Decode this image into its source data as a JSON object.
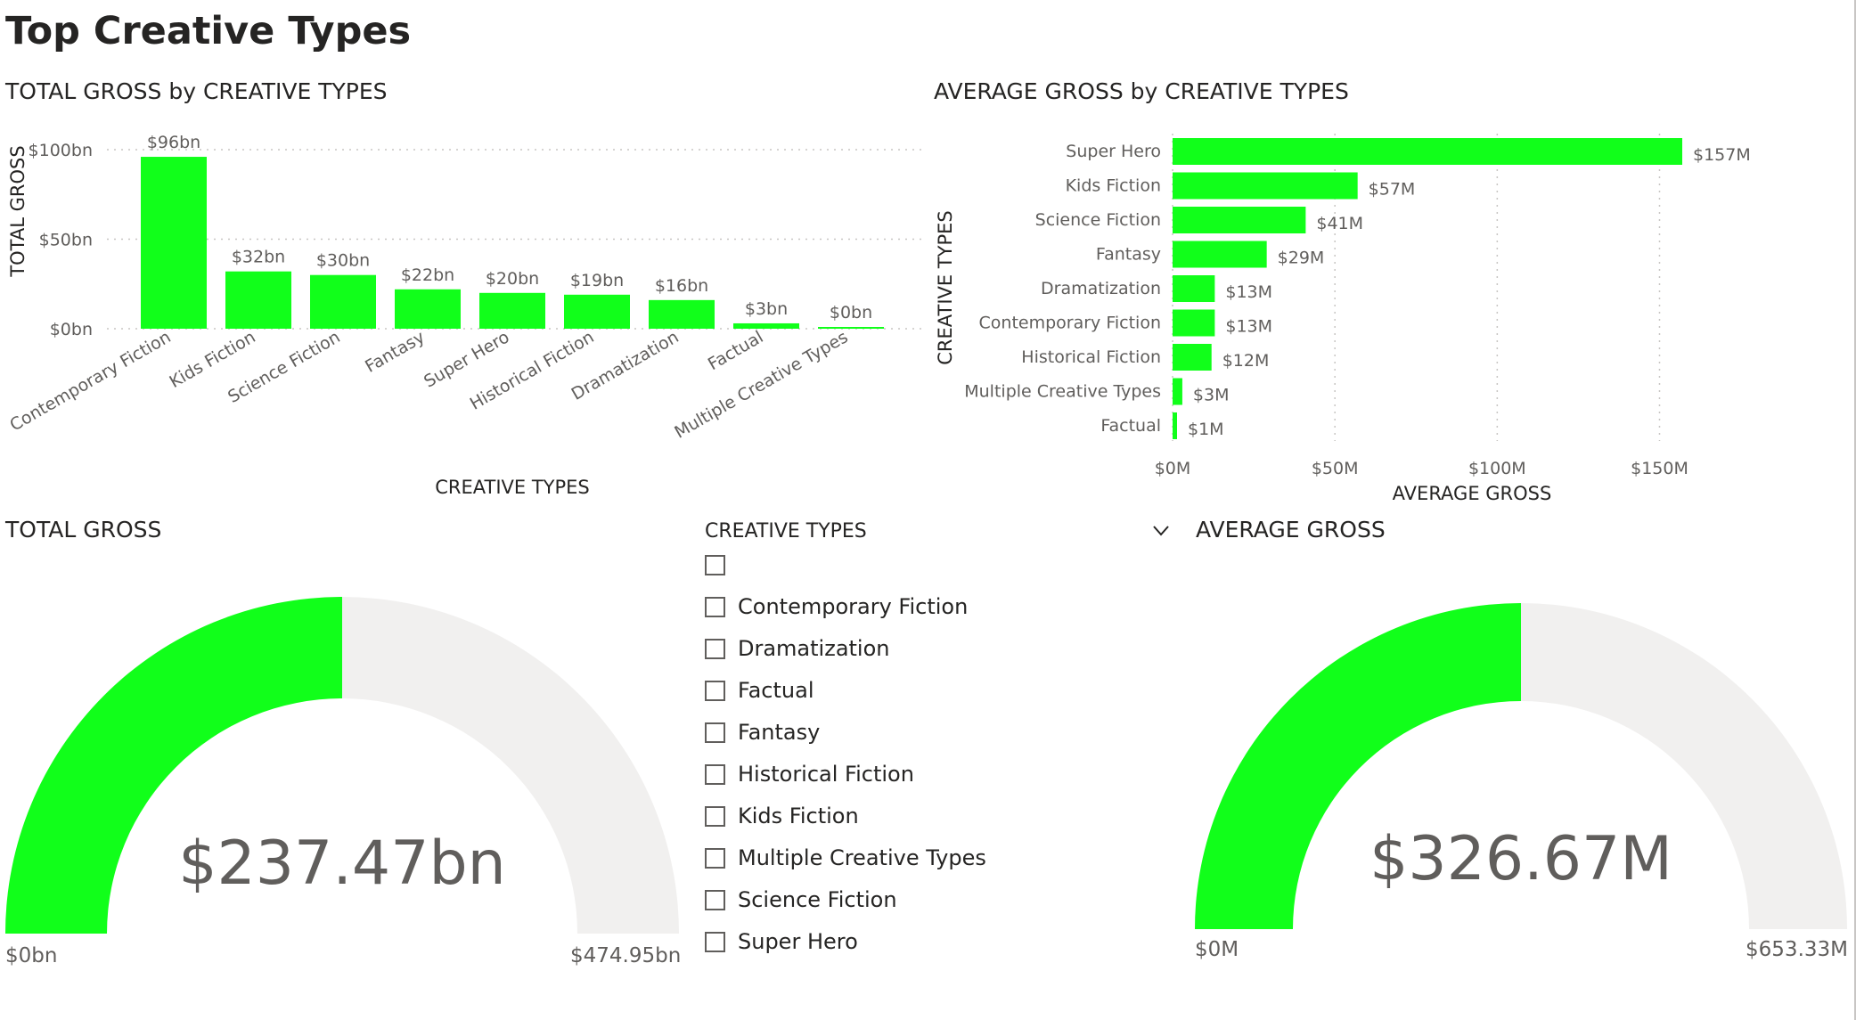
{
  "page": {
    "title": "Top Creative Types"
  },
  "colors": {
    "accent": "#11FF1A",
    "track": "#F1F0EF",
    "text": "#252423",
    "muted": "#605E5C",
    "grid": "#C8C6C4"
  },
  "total_bar": {
    "title": "TOTAL GROSS by CREATIVE TYPES",
    "xlabel": "CREATIVE TYPES",
    "ylabel": "TOTAL GROSS",
    "ticks": [
      "$0bn",
      "$50bn",
      "$100bn"
    ],
    "data_labels": [
      "$96bn",
      "$32bn",
      "$30bn",
      "$22bn",
      "$20bn",
      "$19bn",
      "$16bn",
      "$3bn",
      "$0bn"
    ]
  },
  "avg_bar": {
    "title": "AVERAGE GROSS by CREATIVE TYPES",
    "xlabel": "AVERAGE GROSS",
    "ylabel": "CREATIVE TYPES",
    "ticks": [
      "$0M",
      "$50M",
      "$100M",
      "$150M"
    ],
    "data_labels": [
      "$157M",
      "$57M",
      "$41M",
      "$29M",
      "$13M",
      "$13M",
      "$12M",
      "$3M",
      "$1M"
    ]
  },
  "total_gauge": {
    "title": "TOTAL GROSS",
    "value_label": "$237.47bn",
    "min_label": "$0bn",
    "max_label": "$474.95bn",
    "fraction": 0.5
  },
  "avg_gauge": {
    "title": "AVERAGE GROSS",
    "value_label": "$326.67M",
    "min_label": "$0M",
    "max_label": "$653.33M",
    "fraction": 0.5
  },
  "slicer": {
    "title": "CREATIVE TYPES",
    "items": [
      "",
      "Contemporary Fiction",
      "Dramatization",
      "Factual",
      "Fantasy",
      "Historical Fiction",
      "Kids Fiction",
      "Multiple Creative Types",
      "Science Fiction",
      "Super Hero"
    ]
  },
  "chart_data": [
    {
      "type": "bar",
      "title": "TOTAL GROSS by CREATIVE TYPES",
      "xlabel": "CREATIVE TYPES",
      "ylabel": "TOTAL GROSS",
      "categories": [
        "Contemporary Fiction",
        "Kids Fiction",
        "Science Fiction",
        "Fantasy",
        "Super Hero",
        "Historical Fiction",
        "Dramatization",
        "Factual",
        "Multiple Creative Types"
      ],
      "values": [
        96,
        32,
        30,
        22,
        20,
        19,
        16,
        3,
        0.5
      ],
      "units": "$bn",
      "ylim": [
        0,
        100
      ],
      "grid": true,
      "color": "#11FF1A"
    },
    {
      "type": "bar",
      "orientation": "horizontal",
      "title": "AVERAGE GROSS by CREATIVE TYPES",
      "xlabel": "AVERAGE GROSS",
      "ylabel": "CREATIVE TYPES",
      "categories": [
        "Super Hero",
        "Kids Fiction",
        "Science Fiction",
        "Fantasy",
        "Dramatization",
        "Contemporary Fiction",
        "Historical Fiction",
        "Multiple Creative Types",
        "Factual"
      ],
      "values": [
        157,
        57,
        41,
        29,
        13,
        13,
        12,
        3,
        1
      ],
      "units": "$M",
      "xlim": [
        0,
        150
      ],
      "grid": true,
      "color": "#11FF1A"
    }
  ]
}
